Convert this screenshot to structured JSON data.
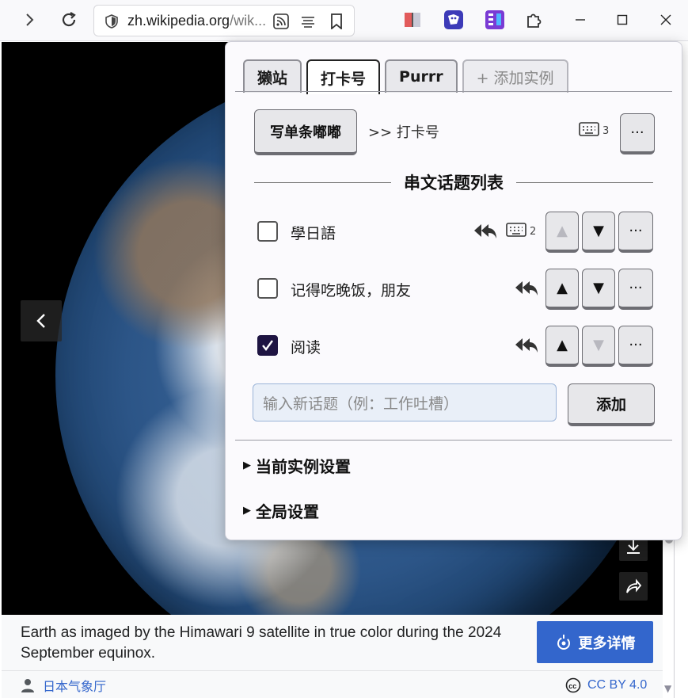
{
  "browser": {
    "url_domain": "zh.wikipedia.org",
    "url_rest": "/wik..."
  },
  "page": {
    "caption": "Earth as imaged by the Himawari 9 satellite in true color during the 2024 September equinox.",
    "more_details_label": "更多详情",
    "author": "日本气象厅",
    "license": "CC BY 4.0"
  },
  "popup": {
    "tabs": [
      {
        "label": "獭站",
        "active": false
      },
      {
        "label": "打卡号",
        "active": true
      },
      {
        "label": "Purrr",
        "active": false
      },
      {
        "label": "+ 添加实例",
        "active": false
      }
    ],
    "write_button": "写单条嘟嘟",
    "breadcrumb": ">> 打卡号",
    "write_shortcut_count": "3",
    "more_glyph": "···",
    "section_title": "串文话题列表",
    "topics": [
      {
        "label": "學日語",
        "checked": false,
        "shortcut_count": "2",
        "up_enabled": false,
        "down_enabled": true
      },
      {
        "label": "记得吃晚饭，朋友",
        "checked": false,
        "shortcut_count": "",
        "up_enabled": true,
        "down_enabled": true
      },
      {
        "label": "阅读",
        "checked": true,
        "shortcut_count": "",
        "up_enabled": true,
        "down_enabled": false
      }
    ],
    "up_glyph": "▲",
    "down_glyph": "▼",
    "new_topic_placeholder": "输入新话题（例：工作吐槽）",
    "add_button": "添加",
    "current_instance_settings": "当前实例设置",
    "global_settings": "全局设置"
  },
  "colors": {
    "accent_blue": "#3366cc",
    "checkbox_checked": "#1e1442",
    "input_bg": "#e9eff8"
  }
}
